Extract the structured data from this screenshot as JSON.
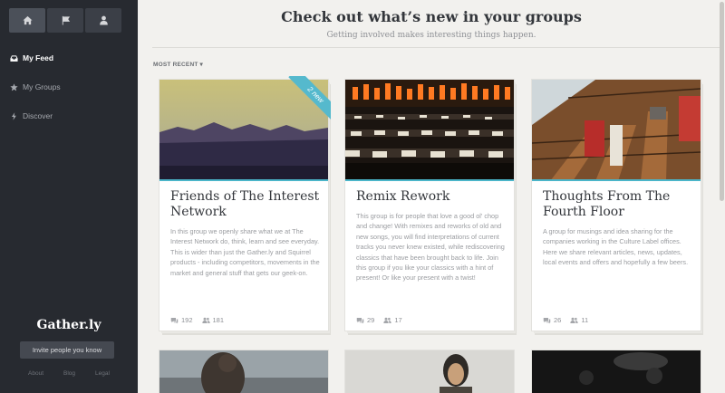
{
  "sidebar": {
    "tabs": [
      {
        "icon": "home-icon",
        "active": true
      },
      {
        "icon": "flag-icon",
        "active": false
      },
      {
        "icon": "user-icon",
        "active": false
      }
    ],
    "nav": [
      {
        "label": "My Feed",
        "icon": "inbox-icon",
        "active": true
      },
      {
        "label": "My Groups",
        "icon": "star-icon",
        "active": false
      },
      {
        "label": "Discover",
        "icon": "bolt-icon",
        "active": false
      }
    ],
    "brand": "Gather.ly",
    "invite_label": "Invite people you know",
    "footer": [
      "About",
      "Blog",
      "Legal"
    ]
  },
  "main": {
    "title": "Check out what’s new in your groups",
    "subtitle": "Getting involved makes interesting things happen.",
    "sort_label": "MOST RECENT ▾",
    "accent_color": "#4bb5c9",
    "cards": [
      {
        "title": "Friends of The Interest Network",
        "description": "In this group we openly share what we at The Interest Network do, think, learn and see everyday. This is wider than just the Gather.ly and Squirrel products - including competitors, movements in the market and general stuff that gets our geek-on.",
        "ribbon": "2 new",
        "comments": "192",
        "members": "181"
      },
      {
        "title": "Remix Rework",
        "description": "This group is for people that love a good ol' chop and change! With remixes and reworks of old and new songs, you will find interpretations of current tracks you never knew existed, while rediscovering classics that have been brought back to life. Join this group if you like your classics with a hint of present! Or like your present with a twist!",
        "comments": "29",
        "members": "17"
      },
      {
        "title": "Thoughts From The Fourth Floor",
        "description": "A group for musings and idea sharing for the companies working in the Culture Label offices. Here we share relevant articles, news, updates, local events and offers and hopefully a few beers.",
        "comments": "26",
        "members": "11"
      }
    ]
  }
}
